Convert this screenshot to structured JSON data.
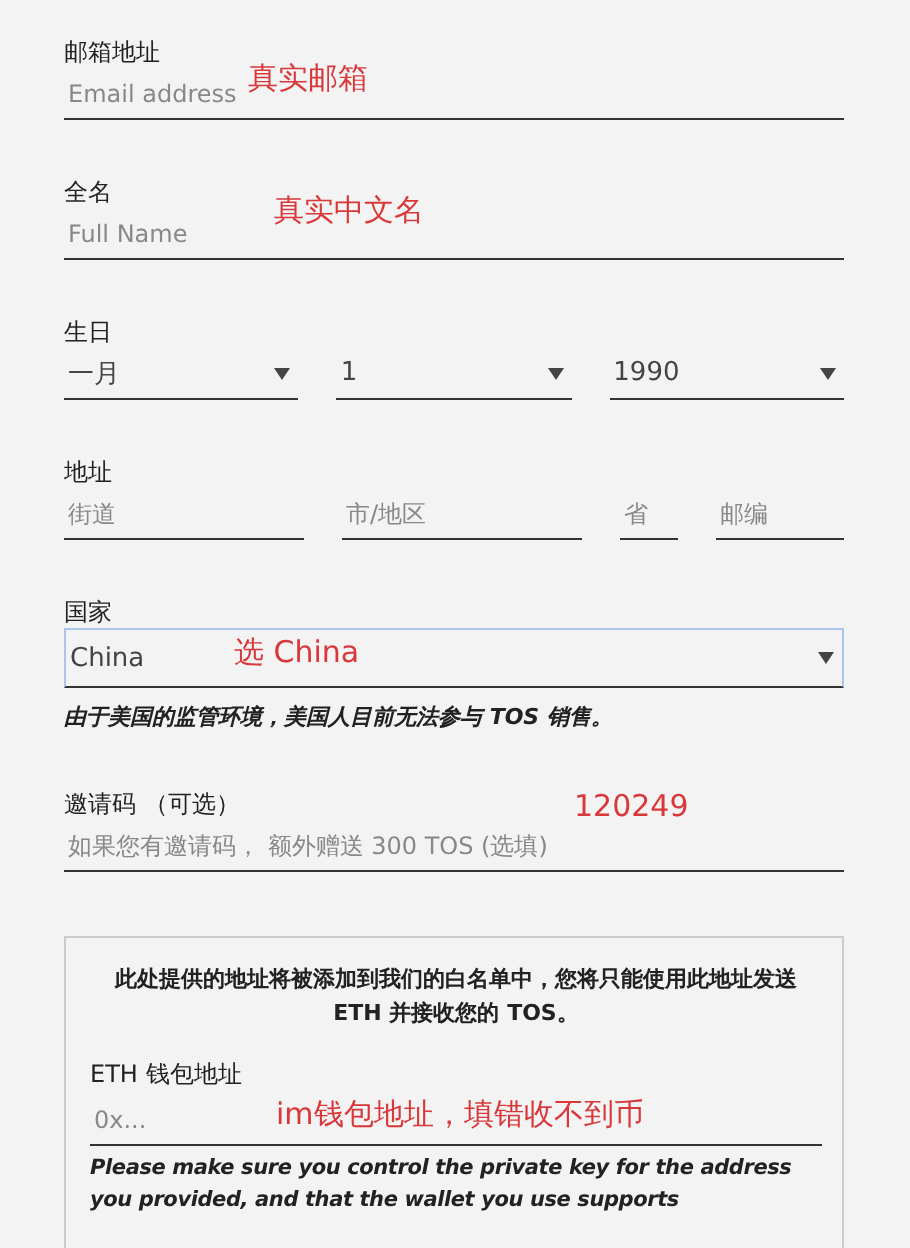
{
  "fields": [
    {
      "kind": "text",
      "label": "邮箱地址",
      "placeholder": "Email address",
      "note": "真实邮箱"
    },
    {
      "kind": "text",
      "label": "全名",
      "placeholder": "Full Name",
      "note": "真实中文名"
    },
    {
      "kind": "selects",
      "label": "生日",
      "selects": [
        {
          "value": "一月"
        },
        {
          "value": "1"
        },
        {
          "value": "1990"
        }
      ]
    },
    {
      "kind": "address",
      "label": "地址",
      "inputs": [
        {
          "placeholder": "街道"
        },
        {
          "placeholder": "市/地区"
        },
        {
          "placeholder": "省"
        },
        {
          "placeholder": "邮编"
        }
      ]
    },
    {
      "kind": "select",
      "label": "国家",
      "value": "China",
      "focused": true,
      "note": "选 China",
      "warning": "由于美国的监管环境，美国人目前无法参与 TOS 销售。"
    },
    {
      "kind": "text",
      "label": "邀请码 （可选）",
      "placeholder": "如果您有邀请码， 额外赠送 300 TOS (选填)",
      "note": "120249"
    }
  ],
  "whitelist": {
    "message": "此处提供的地址将被添加到我们的白名单中，您将只能使用此地址发送 **ETH** 并接收您的 **TOS**。",
    "wallet_label": "ETH 钱包地址",
    "placeholder": "0x...",
    "note": "im钱包地址，填错收不到币",
    "warning": "Please make sure you control the private key for the address you provided, and that the wallet you use supports"
  }
}
